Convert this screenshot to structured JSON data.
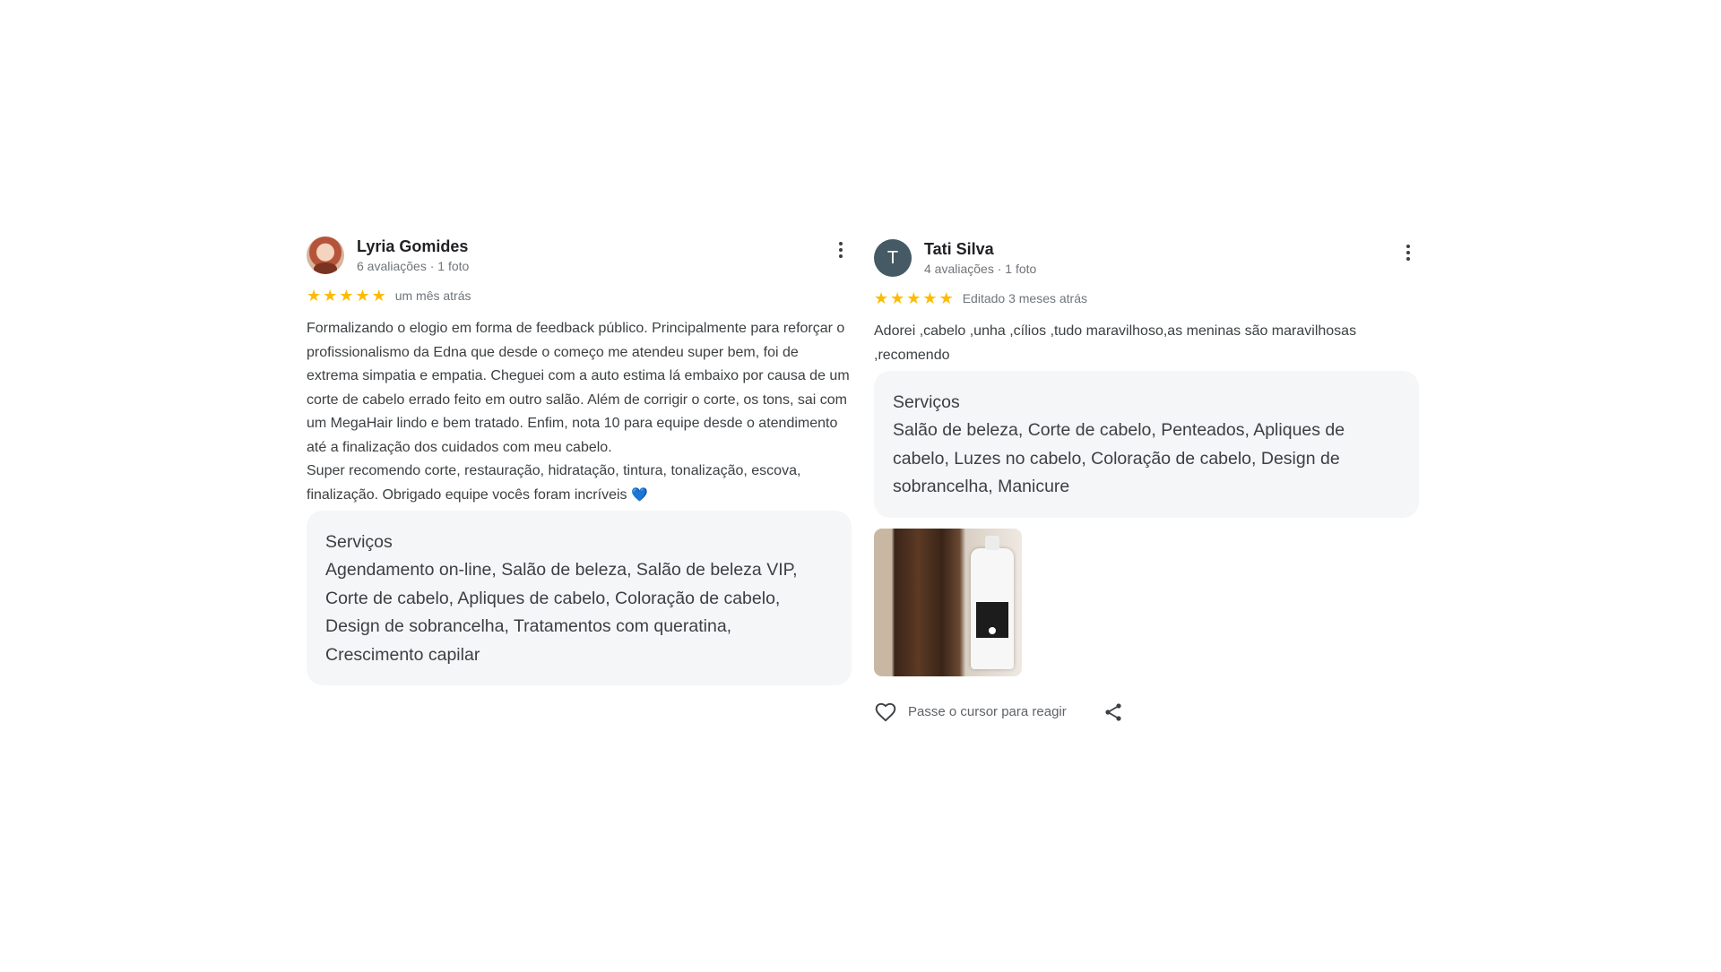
{
  "reviews": [
    {
      "author": "Lyria Gomides",
      "meta": "6 avaliações · 1 foto",
      "stars": 5,
      "date": "um mês atrás",
      "text_paragraphs": [
        "Formalizando o elogio em forma de feedback público. Principalmente para reforçar o profissionalismo da Edna que desde o começo me atendeu super bem, foi de extrema simpatia e empatia. Cheguei com a auto estima lá embaixo por causa de um corte de cabelo errado feito em outro salão. Além de corrigir o corte, os tons, sai com um MegaHair lindo e bem tratado. Enfim, nota 10 para equipe desde o atendimento até a finalização dos cuidados com meu cabelo.",
        "Super recomendo corte, restauração, hidratação, tintura, tonalização, escova, finalização. Obrigado equipe vocês foram incríveis"
      ],
      "emoji": "💙",
      "services_title": "Serviços",
      "services": "Agendamento on-line, Salão de beleza, Salão de beleza VIP, Corte de cabelo, Apliques de cabelo, Coloração de cabelo, Design de sobrancelha, Tratamentos com queratina, Crescimento capilar"
    },
    {
      "author": "Tati Silva",
      "avatar_letter": "T",
      "avatar_color": "#455a64",
      "meta": "4 avaliações · 1 foto",
      "stars": 5,
      "date": "Editado 3 meses atrás",
      "text": "Adorei ,cabelo ,unha ,cílios ,tudo maravilhoso,as meninas são maravilhosas ,recomendo",
      "services_title": "Serviços",
      "services": "Salão de beleza, Corte de cabelo, Penteados, Apliques de cabelo, Luzes no cabelo, Coloração de cabelo, Design de sobrancelha, Manicure",
      "react_prompt": "Passe o cursor para reagir"
    }
  ],
  "colors": {
    "star": "#fbbc04",
    "services_bg": "#f5f6f8"
  },
  "icons": [
    "more-vert-icon",
    "star-icon",
    "heart-outline-icon",
    "share-icon"
  ]
}
